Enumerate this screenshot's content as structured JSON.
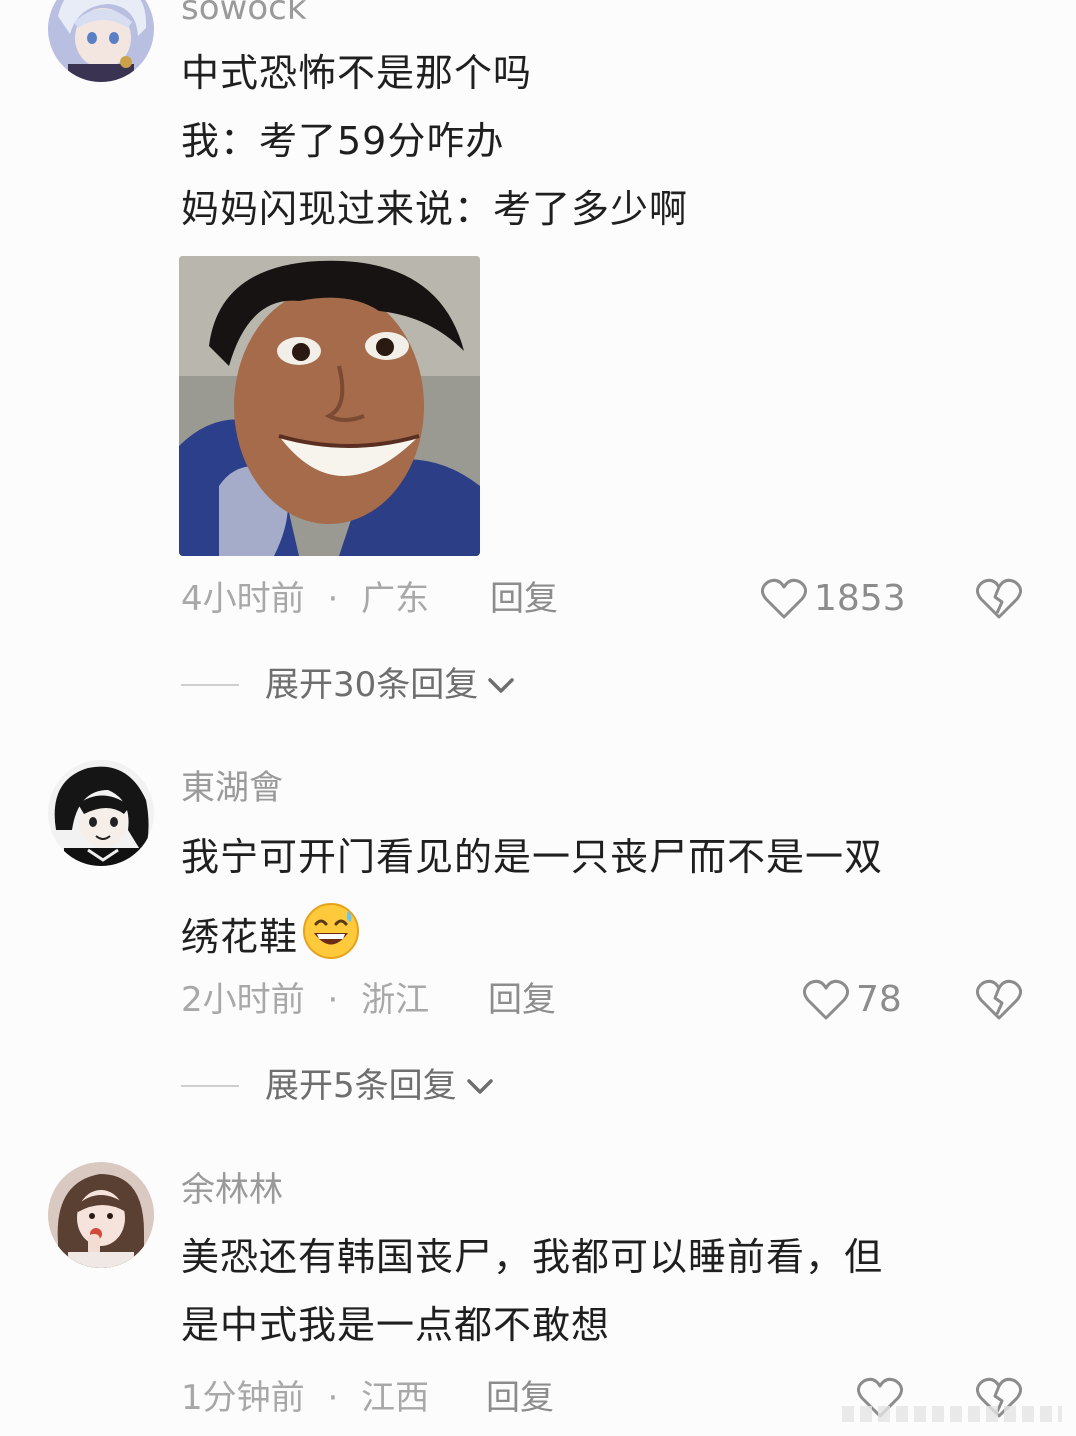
{
  "comments": [
    {
      "username": "sowock",
      "lines": [
        "中式恐怖不是那个吗",
        "我：考了59分咋办",
        "妈妈闪现过来说：考了多少啊"
      ],
      "time": "4小时前",
      "location": "广东",
      "reply_label": "回复",
      "likes": "1853",
      "expand_label": "展开30条回复"
    },
    {
      "username": "東湖會",
      "lines": [
        "我宁可开门看见的是一只丧尸而不是一双",
        "绣花鞋"
      ],
      "emoji": "grinning-sweat-emoji",
      "time": "2小时前",
      "location": "浙江",
      "reply_label": "回复",
      "likes": "78",
      "expand_label": "展开5条回复"
    },
    {
      "username": "余林林",
      "lines": [
        "美恐还有韩国丧尸，我都可以睡前看，但",
        "是中式我是一点都不敢想"
      ],
      "time": "1分钟前",
      "location": "江西",
      "reply_label": "回复"
    }
  ],
  "separator": "·",
  "icons": {
    "like": "heart-outline-icon",
    "dislike": "broken-heart-icon",
    "expand": "chevron-down-icon"
  },
  "colors": {
    "background": "#fcfcfc",
    "text": "#1f1f1f",
    "muted": "#a8a8a8"
  }
}
